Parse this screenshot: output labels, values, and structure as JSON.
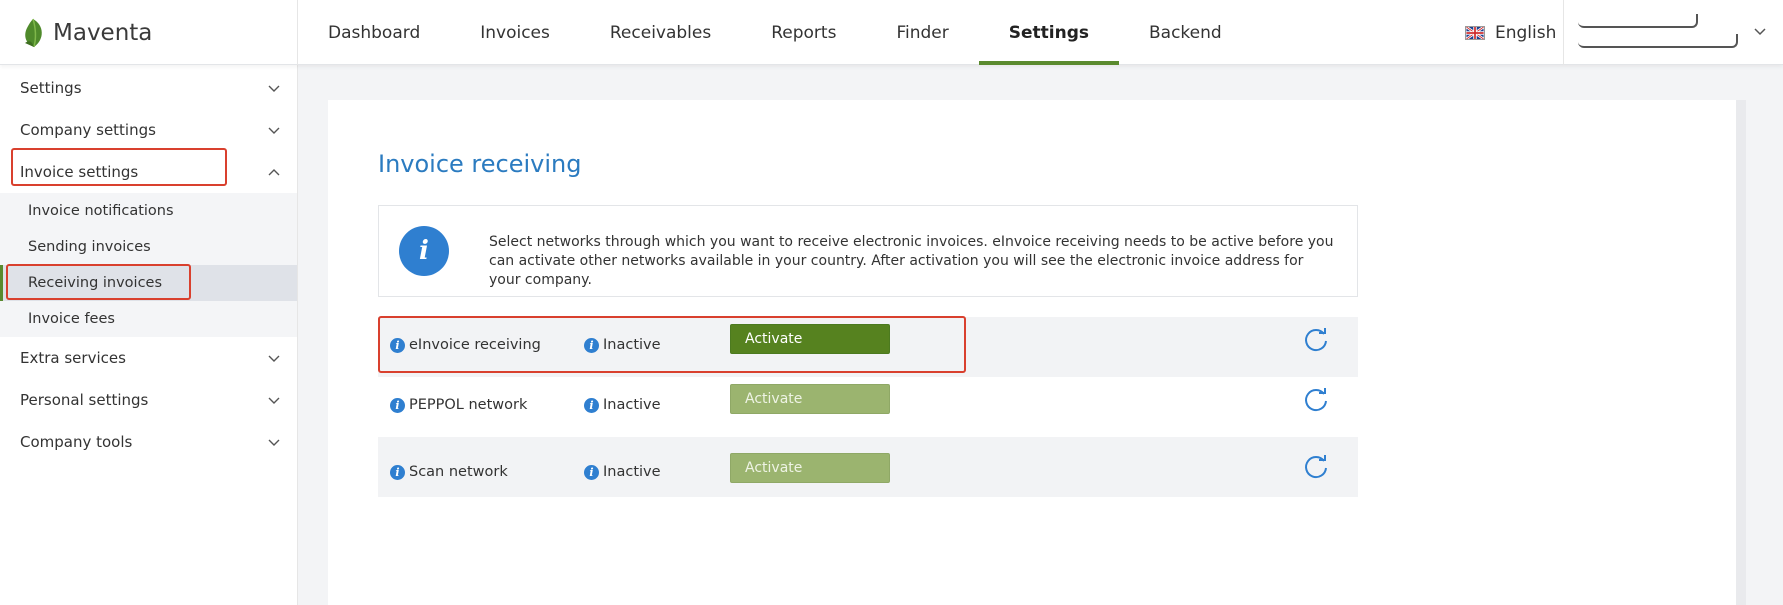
{
  "brand": {
    "name": "Maventa"
  },
  "nav": {
    "tabs": [
      {
        "label": "Dashboard",
        "active": false
      },
      {
        "label": "Invoices",
        "active": false
      },
      {
        "label": "Receivables",
        "active": false
      },
      {
        "label": "Reports",
        "active": false
      },
      {
        "label": "Finder",
        "active": false
      },
      {
        "label": "Settings",
        "active": true
      },
      {
        "label": "Backend",
        "active": false
      }
    ]
  },
  "language": {
    "label": "English",
    "icon": "uk-flag-icon"
  },
  "sidebar": {
    "items": [
      {
        "label": "Settings"
      },
      {
        "label": "Company settings"
      },
      {
        "label": "Invoice settings",
        "expanded": true
      },
      {
        "label": "Extra services"
      },
      {
        "label": "Personal settings"
      },
      {
        "label": "Company tools"
      }
    ],
    "invoice_settings_sub": [
      {
        "label": "Invoice notifications"
      },
      {
        "label": "Sending invoices"
      },
      {
        "label": "Receiving invoices",
        "active": true
      },
      {
        "label": "Invoice fees"
      }
    ]
  },
  "main": {
    "title": "Invoice receiving",
    "info_text": "Select networks through which you want to receive electronic invoices. eInvoice receiving needs to be active before you can activate other networks available in your country. After activation you will see the electronic invoice address for your company.",
    "networks": [
      {
        "name": "eInvoice receiving",
        "status": "Inactive",
        "action": "Activate",
        "enabled": true
      },
      {
        "name": "PEPPOL network",
        "status": "Inactive",
        "action": "Activate",
        "enabled": false
      },
      {
        "name": "Scan network",
        "status": "Inactive",
        "action": "Activate",
        "enabled": false
      }
    ]
  },
  "colors": {
    "accent_green": "#5a8a2e",
    "title_blue": "#2b7bc0",
    "highlight_red": "#d9402e"
  }
}
